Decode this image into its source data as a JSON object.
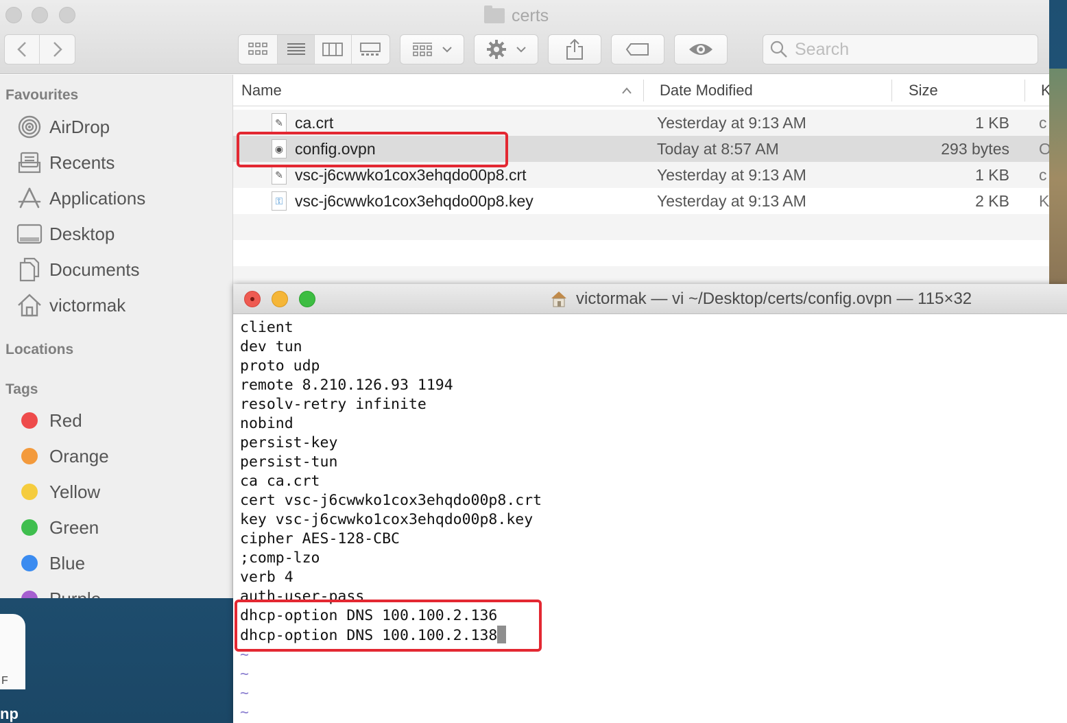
{
  "finder": {
    "title": "certs",
    "search_placeholder": "Search",
    "sidebar": {
      "favourites_heading": "Favourites",
      "favourites": [
        {
          "label": "AirDrop",
          "icon": "airdrop-icon"
        },
        {
          "label": "Recents",
          "icon": "recents-icon"
        },
        {
          "label": "Applications",
          "icon": "applications-icon"
        },
        {
          "label": "Desktop",
          "icon": "desktop-icon"
        },
        {
          "label": "Documents",
          "icon": "documents-icon"
        },
        {
          "label": "victormak",
          "icon": "home-icon"
        }
      ],
      "locations_heading": "Locations",
      "tags_heading": "Tags",
      "tags": [
        {
          "label": "Red",
          "color": "#ee4b4b"
        },
        {
          "label": "Orange",
          "color": "#f39a3c"
        },
        {
          "label": "Yellow",
          "color": "#f5cc3e"
        },
        {
          "label": "Green",
          "color": "#3fbe4e"
        },
        {
          "label": "Blue",
          "color": "#3a8bf0"
        },
        {
          "label": "Purple",
          "color": "#a55fd0"
        }
      ]
    },
    "columns": {
      "name": "Name",
      "date_modified": "Date Modified",
      "size": "Size",
      "kind": "K"
    },
    "files": [
      {
        "name": "ca.crt",
        "date": "Yesterday at 9:13 AM",
        "size": "1 KB",
        "kind": "c"
      },
      {
        "name": "config.ovpn",
        "date": "Today at 8:57 AM",
        "size": "293 bytes",
        "kind": "O"
      },
      {
        "name": "vsc-j6cwwko1cox3ehqdo00p8.crt",
        "date": "Yesterday at 9:13 AM",
        "size": "1 KB",
        "kind": "c"
      },
      {
        "name": "vsc-j6cwwko1cox3ehqdo00p8.key",
        "date": "Yesterday at 9:13 AM",
        "size": "2 KB",
        "kind": "K"
      }
    ]
  },
  "terminal": {
    "title": "victormak — vi ~/Desktop/certs/config.ovpn — 115×32",
    "lines": [
      "client",
      "dev tun",
      "proto udp",
      "remote 8.210.126.93 1194",
      "resolv-retry infinite",
      "nobind",
      "persist-key",
      "persist-tun",
      "ca ca.crt",
      "cert vsc-j6cwwko1cox3ehqdo00p8.crt",
      "key vsc-j6cwwko1cox3ehqdo00p8.key",
      "cipher AES-128-CBC",
      ";comp-lzo",
      "verb 4",
      "auth-user-pass",
      "dhcp-option DNS 100.100.2.136",
      "dhcp-option DNS 100.100.2.138"
    ],
    "tilde": "~"
  },
  "desktop": {
    "doc_letter": "F",
    "label": "np"
  },
  "colors": {
    "highlight": "#e32832",
    "close": "#ee5b52",
    "minimize": "#f5b638",
    "zoom": "#3dbd42"
  }
}
